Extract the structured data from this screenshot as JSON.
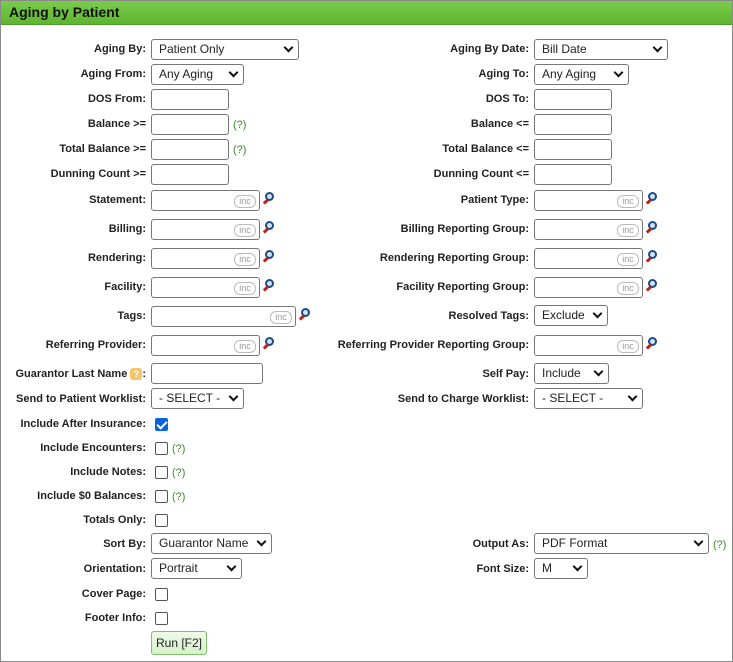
{
  "title": "Aging by Patient",
  "help_text": "(?)",
  "inc_text": "inc",
  "fields": {
    "aging_by": {
      "label": "Aging By:",
      "value": "Patient Only"
    },
    "aging_by_date": {
      "label": "Aging By Date:",
      "value": "Bill Date"
    },
    "aging_from": {
      "label": "Aging From:",
      "value": "Any Aging"
    },
    "aging_to": {
      "label": "Aging To:",
      "value": "Any Aging"
    },
    "dos_from": {
      "label": "DOS From:",
      "value": ""
    },
    "dos_to": {
      "label": "DOS To:",
      "value": ""
    },
    "balance_gte": {
      "label": "Balance >=",
      "value": ""
    },
    "balance_lte": {
      "label": "Balance <=",
      "value": ""
    },
    "total_balance_gte": {
      "label": "Total Balance >=",
      "value": ""
    },
    "total_balance_lte": {
      "label": "Total Balance <=",
      "value": ""
    },
    "dunning_count_gte": {
      "label": "Dunning Count >=",
      "value": ""
    },
    "dunning_count_lte": {
      "label": "Dunning Count <=",
      "value": ""
    },
    "statement": {
      "label": "Statement:",
      "value": ""
    },
    "patient_type": {
      "label": "Patient Type:",
      "value": ""
    },
    "billing": {
      "label": "Billing:",
      "value": ""
    },
    "billing_reporting_group": {
      "label": "Billing Reporting Group:",
      "value": ""
    },
    "rendering": {
      "label": "Rendering:",
      "value": ""
    },
    "rendering_reporting_group": {
      "label": "Rendering Reporting Group:",
      "value": ""
    },
    "facility": {
      "label": "Facility:",
      "value": ""
    },
    "facility_reporting_group": {
      "label": "Facility Reporting Group:",
      "value": ""
    },
    "tags": {
      "label": "Tags:",
      "value": ""
    },
    "resolved_tags": {
      "label": "Resolved Tags:",
      "value": "Exclude"
    },
    "referring_provider": {
      "label": "Referring Provider:",
      "value": ""
    },
    "referring_provider_reporting_group": {
      "label": "Referring Provider Reporting Group:",
      "value": ""
    },
    "guarantor_last_name": {
      "label": "Guarantor Last Name",
      "value": ""
    },
    "self_pay": {
      "label": "Self Pay:",
      "value": "Include"
    },
    "send_to_patient_worklist": {
      "label": "Send to Patient Worklist:",
      "value": "- SELECT -"
    },
    "send_to_charge_worklist": {
      "label": "Send to Charge Worklist:",
      "value": "- SELECT -"
    },
    "include_after_insurance": {
      "label": "Include After Insurance:",
      "checked": true
    },
    "include_encounters": {
      "label": "Include Encounters:",
      "checked": false
    },
    "include_notes": {
      "label": "Include Notes:",
      "checked": false
    },
    "include_zero_balances": {
      "label": "Include $0 Balances:",
      "checked": false
    },
    "totals_only": {
      "label": "Totals Only:",
      "checked": false
    },
    "sort_by": {
      "label": "Sort By:",
      "value": "Guarantor Name"
    },
    "output_as": {
      "label": "Output As:",
      "value": "PDF Format"
    },
    "orientation": {
      "label": "Orientation:",
      "value": "Portrait"
    },
    "font_size": {
      "label": "Font Size:",
      "value": "M"
    },
    "cover_page": {
      "label": "Cover Page:",
      "checked": false
    },
    "footer_info": {
      "label": "Footer Info:",
      "checked": false
    }
  },
  "run_button": "Run [F2]"
}
